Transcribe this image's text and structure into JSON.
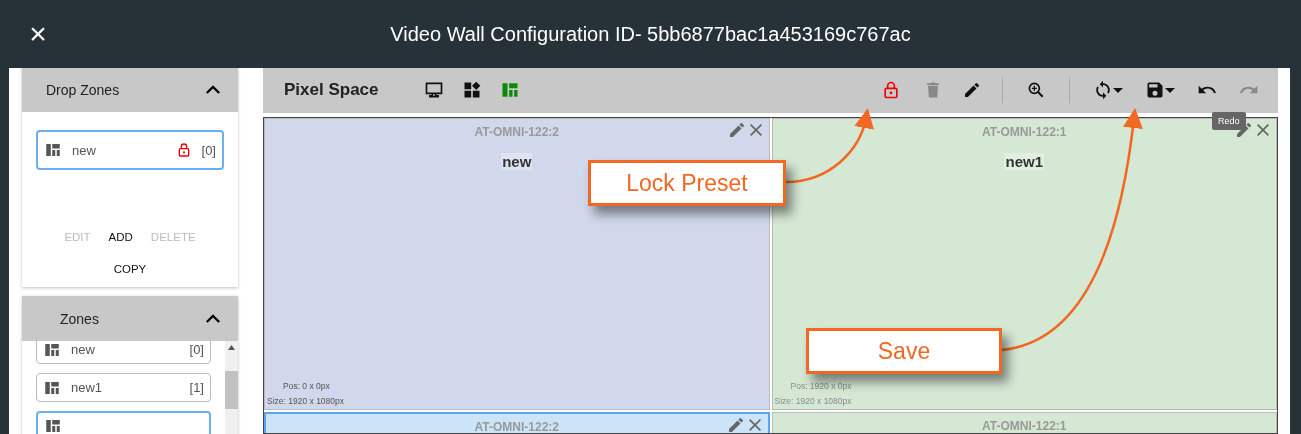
{
  "window": {
    "title": "Video Wall Configuration ID- 5bb6877bac1a453169c767ac",
    "close": "×"
  },
  "drop_zones": {
    "title": "Drop Zones",
    "expanded": true,
    "items": [
      {
        "name": "new",
        "count": "[0]",
        "locked": true,
        "selected": true
      }
    ],
    "actions": [
      {
        "label": "EDIT",
        "disabled": true
      },
      {
        "label": "ADD",
        "disabled": false
      },
      {
        "label": "DELETE",
        "disabled": true
      },
      {
        "label": "COPY",
        "disabled": false
      }
    ]
  },
  "zones": {
    "title": "Zones",
    "expanded": true,
    "items": [
      {
        "name": "new",
        "count": "[0]",
        "selected": false
      },
      {
        "name": "new1",
        "count": "[1]",
        "selected": false
      },
      {
        "selected": true
      }
    ]
  },
  "toolbar": {
    "title": "Pixel Space",
    "views": [
      {
        "kind": "monitor",
        "selected": false
      },
      {
        "kind": "widgets",
        "selected": false
      },
      {
        "kind": "layout",
        "selected": true
      }
    ],
    "tools": [
      {
        "kind": "lock",
        "disabled": false
      },
      {
        "kind": "trash",
        "disabled": true
      },
      {
        "kind": "pencil",
        "disabled": false
      },
      {
        "kind": "sep"
      },
      {
        "kind": "zoom",
        "disabled": false
      },
      {
        "kind": "sep"
      },
      {
        "kind": "sync",
        "disabled": false
      },
      {
        "kind": "save",
        "disabled": false
      },
      {
        "kind": "undo",
        "disabled": false
      },
      {
        "kind": "redo",
        "disabled": true
      }
    ],
    "tooltip": "Redo"
  },
  "canvas": {
    "zones": [
      {
        "device": "AT-OMNI-122:2",
        "name": "new",
        "pos": "Pos: 0 x 0px",
        "size": "Size: 1920 x 1080px",
        "color": "#d2d8ec",
        "selected": false,
        "tools": true
      },
      {
        "device": "AT-OMNI-122:1",
        "name": "new1",
        "pos": "Pos: 1920 x 0px",
        "size": "Size: 1920 x 1080px",
        "color": "#d5e8d4",
        "selected": false,
        "tools": true
      },
      {
        "device": "AT-OMNI-122:2",
        "color": "#cce4f7",
        "selected": true,
        "tools": true
      },
      {
        "device": "AT-OMNI-122:1",
        "color": "#d5e8d4",
        "selected": false,
        "tools": false
      }
    ]
  },
  "callouts": [
    {
      "text": "Lock Preset"
    },
    {
      "text": "Save"
    }
  ]
}
